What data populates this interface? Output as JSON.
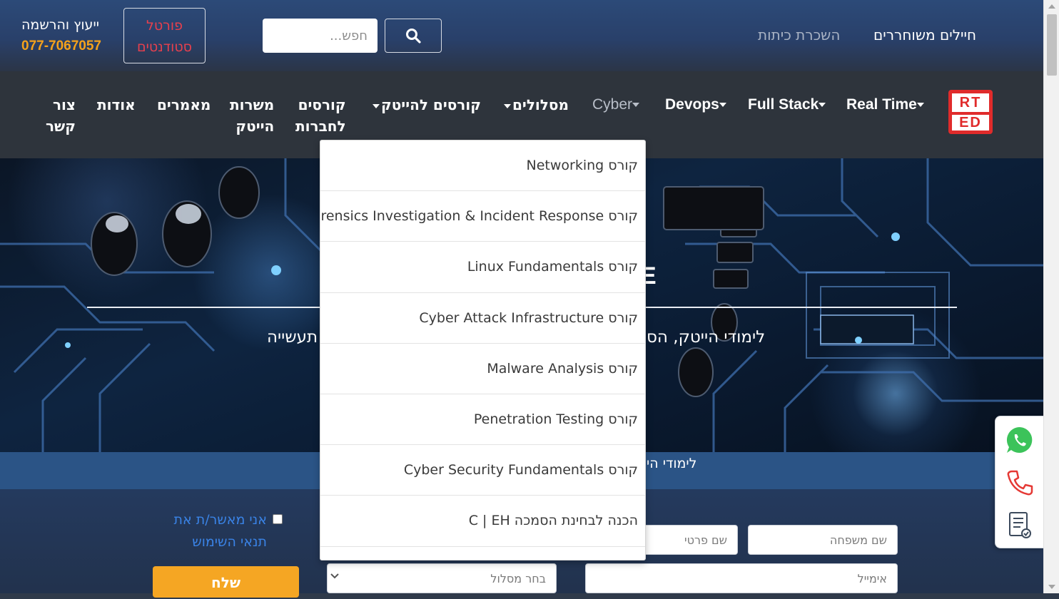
{
  "colors": {
    "accent_orange": "#f5a623",
    "portal_red": "#e8404d",
    "nav_bg": "#2e343c",
    "topbar_blue": "#29406a",
    "brand_red": "#e02b2b",
    "link_blue": "#3a83e6"
  },
  "topbar": {
    "contact_label": "ייעוץ והרשמה",
    "contact_phone": "077-7067057",
    "portal_line1": "פורטל",
    "portal_line2": "סטודנטים",
    "search_placeholder": "חפש...",
    "search_icon": "search-icon",
    "link_rental": "השכרת כיתות",
    "link_soldiers": "חיילים משוחררים"
  },
  "logo": {
    "line1": "RT",
    "line2": "ED"
  },
  "nav": {
    "real_time": "Real Time",
    "full_stack": "Full Stack",
    "devops": "Devops",
    "cyber": "Cyber",
    "tracks": "מסלולים",
    "hitech_courses": "קורסים להייטק",
    "company_courses_1": "קורסים",
    "company_courses_2": "לחברות",
    "hitech_jobs_1": "משרות",
    "hitech_jobs_2": "הייטק",
    "articles": "מאמרים",
    "about": "אודות",
    "contact_1": "צור",
    "contact_2": "קשר"
  },
  "dropdown": {
    "items": [
      "קורס Networking",
      "קורס Forensics Investigation & Incident Response",
      "קורס Linux Fundamentals",
      "קורס Cyber Attack Infrastructure",
      "קורס Malware Analysis",
      "קורס Penetration Testing",
      "קורס Cyber Security Fundamentals",
      "הכנה לבחינת הסמכה C | EH"
    ]
  },
  "hero": {
    "partial_title": "E",
    "subtitle_right": "לימודי הייטק, הס",
    "subtitle_left": "תעשייה"
  },
  "strip": {
    "text": "לימודי הי"
  },
  "form": {
    "consent_line1": "אני מאשר/ת את",
    "consent_line2": "תנאי השימוש",
    "first_name_placeholder": "שם פרטי",
    "last_name_placeholder": "שם משפחה",
    "email_placeholder": "אימייל",
    "track_select": "בחר מסלול",
    "submit_label": "שלח"
  },
  "side_widget": {
    "whatsapp_icon": "whatsapp-icon",
    "phone_icon": "phone-icon",
    "form_icon": "form-icon"
  }
}
